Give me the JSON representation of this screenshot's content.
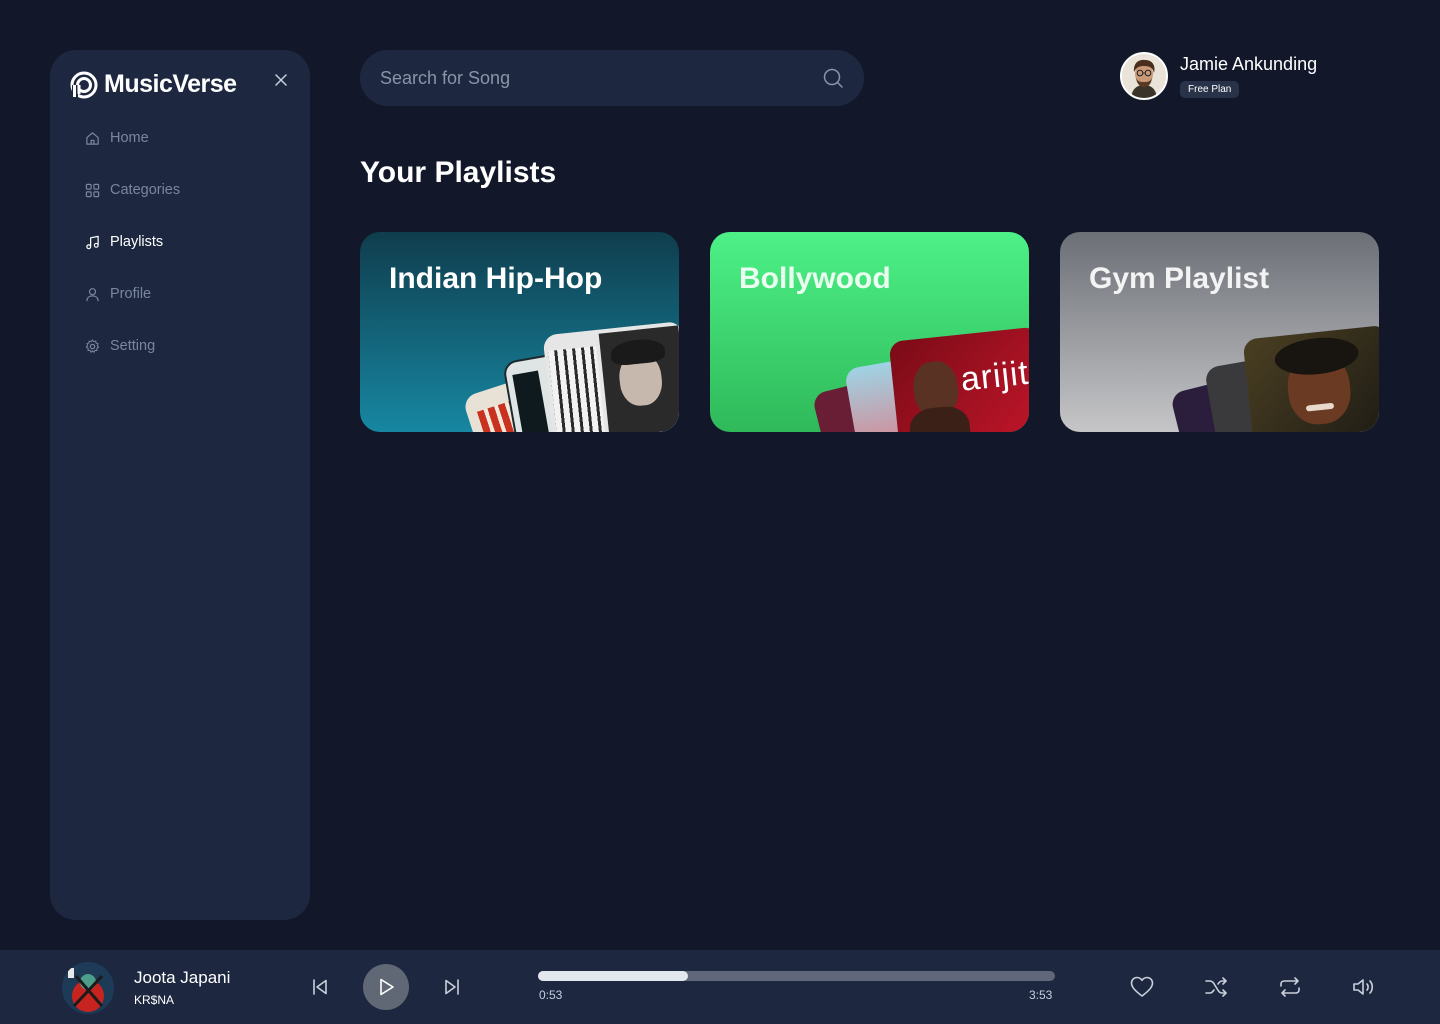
{
  "brand": {
    "name": "MusicVerse"
  },
  "sidebar": {
    "items": [
      {
        "label": "Home",
        "icon": "home-icon"
      },
      {
        "label": "Categories",
        "icon": "grid-icon"
      },
      {
        "label": "Playlists",
        "icon": "music-note-icon",
        "active": true
      },
      {
        "label": "Profile",
        "icon": "user-icon"
      },
      {
        "label": "Setting",
        "icon": "gear-icon"
      }
    ]
  },
  "search": {
    "placeholder": "Search for Song",
    "value": ""
  },
  "user": {
    "name": "Jamie Ankunding",
    "plan": "Free Plan"
  },
  "main": {
    "title": "Your Playlists",
    "playlists": [
      {
        "title": "Indian Hip-Hop"
      },
      {
        "title": "Bollywood",
        "cover_text": "arijit"
      },
      {
        "title": "Gym Playlist"
      }
    ]
  },
  "player": {
    "track_title": "Joota Japani",
    "artist": "KR$NA",
    "current_time": "0:53",
    "total_time": "3:53",
    "progress": 0.29
  },
  "colors": {
    "background": "#12172a",
    "panel": "#1d2840",
    "muted_text": "#7a869e",
    "hiphop_card": "#1787a2",
    "bollywood_card": "#4df187",
    "gym_card": "#9a9b9e"
  }
}
